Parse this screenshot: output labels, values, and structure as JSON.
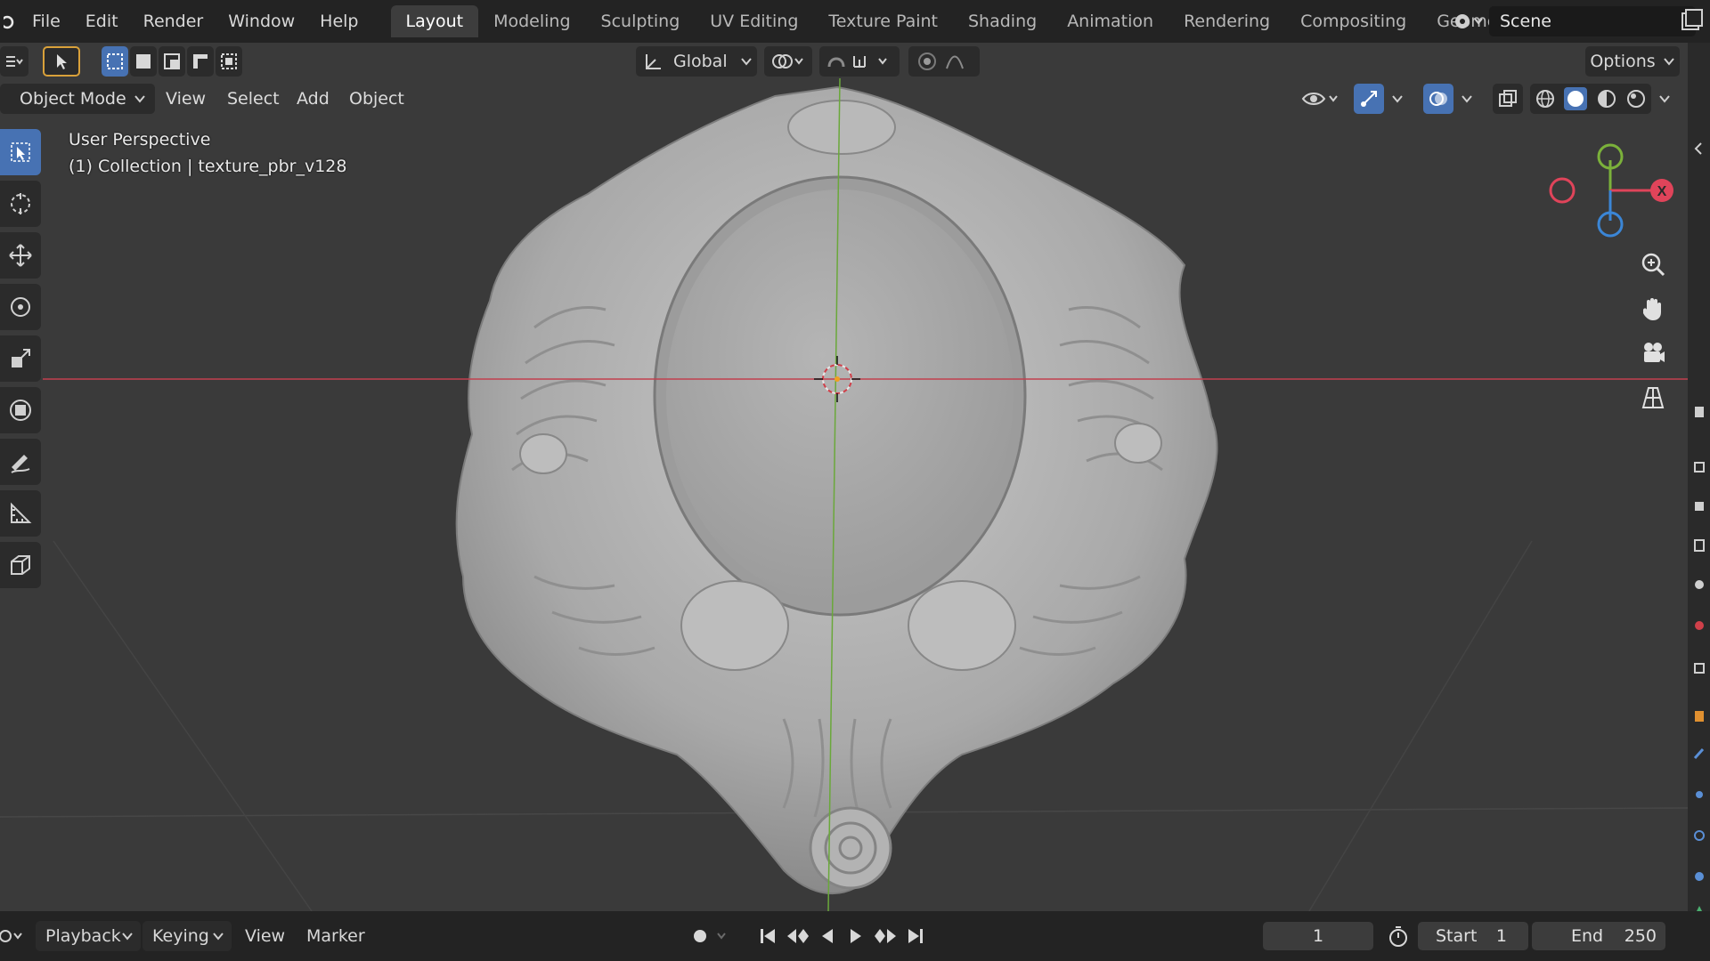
{
  "menus": [
    "File",
    "Edit",
    "Render",
    "Window",
    "Help"
  ],
  "workspace_tabs": [
    {
      "label": "Layout",
      "active": true
    },
    {
      "label": "Modeling",
      "active": false
    },
    {
      "label": "Sculpting",
      "active": false
    },
    {
      "label": "UV Editing",
      "active": false
    },
    {
      "label": "Texture Paint",
      "active": false
    },
    {
      "label": "Shading",
      "active": false
    },
    {
      "label": "Animation",
      "active": false
    },
    {
      "label": "Rendering",
      "active": false
    },
    {
      "label": "Compositing",
      "active": false
    },
    {
      "label": "Geometry Nod",
      "active": false
    }
  ],
  "scene": {
    "name": "Scene"
  },
  "tool_header": {
    "orientation": "Global",
    "options_label": "Options"
  },
  "view_header": {
    "mode": "Object Mode",
    "menus": [
      "View",
      "Select",
      "Add",
      "Object"
    ]
  },
  "overlay": {
    "view_name": "User Perspective",
    "collection_info": "(1) Collection | texture_pbr_v128"
  },
  "gizmo": {
    "x_label": "X",
    "colors": {
      "x": "#e0445a",
      "y": "#7bb13a",
      "z": "#3b86d6"
    }
  },
  "timeline": {
    "menus": [
      "Playback",
      "Keying",
      "View",
      "Marker"
    ],
    "current_frame": "1",
    "start_label": "Start",
    "start_value": "1",
    "end_label": "End",
    "end_value": "250"
  },
  "colors": {
    "accent": "#4772b3",
    "viewport_bg": "#3a3a3a",
    "axis_red": "#c2404e",
    "axis_green": "#6aa83a"
  }
}
